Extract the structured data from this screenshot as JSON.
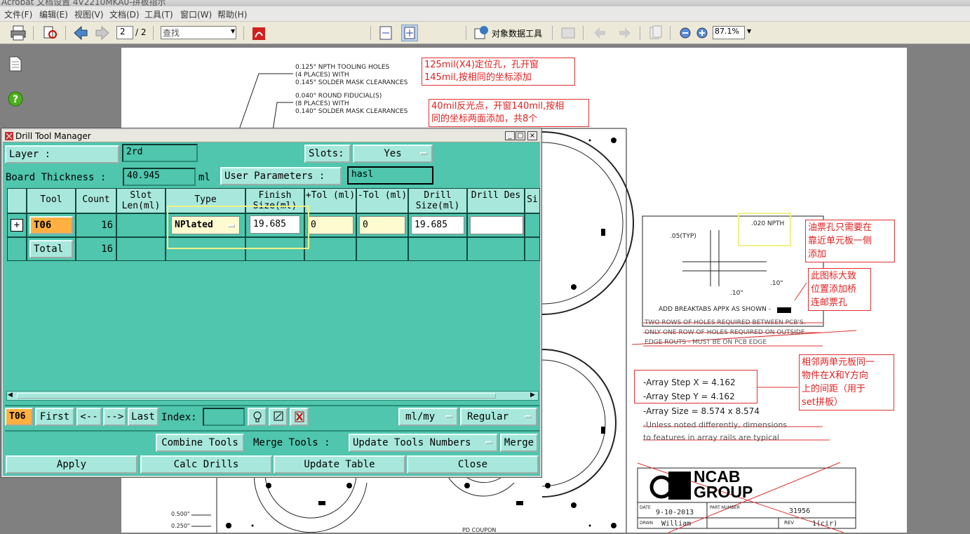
{
  "app": {
    "window_title": "Acrobat 文档设置 4V2210MKA0-拼板指示"
  },
  "menu": [
    "文件(F)",
    "编辑(E)",
    "视图(V)",
    "文档(D)",
    "工具(T)",
    "窗口(W)",
    "帮助(H)"
  ],
  "toolbar": {
    "page_current": "2",
    "page_total": "/ 2",
    "find_placeholder": "查找",
    "object_data_tool": "对象数据工具",
    "zoom": "87.1%"
  },
  "drawing": {
    "hole_note": [
      "0.125\" NPTH TOOLING HOLES",
      "(4 PLACES) WITH",
      "0.145\" SOLDER MASK CLEARANCES"
    ],
    "fid_note": [
      "0.040\" ROUND FIDUCIAL(S)",
      "(8 PLACES) WITH",
      "0.140\" SOLDER MASK CLEARANCES"
    ],
    "npth": ".020 NPTH",
    "typ": ".05(TYP)",
    "dim10a": ".10\"",
    "dim10b": ".10\"",
    "breaktab": "ADD BREAKTABS APPX AS SHOWN -",
    "rows1": "TWO ROWS OF HOLES REQUIRED BETWEEN PCB'S.",
    "rows2": "ONLY ONE ROW OF HOLES REQUIRED ON OUTSIDE",
    "rows3": "EDGE ROUTS - MUST BE ON PCB EDGE",
    "step_x": "-Array Step X = 4.162",
    "step_y": "-Array Step Y = 4.162",
    "array_size": "-Array Size = 8.574 x 8.574",
    "unless1": "-Unless noted differently, dimensions",
    "unless2": "to features in array rails are typical",
    "logo1": "NCAB",
    "logo2": "GROUP",
    "date_label": "DATE",
    "date": "9-10-2013",
    "part_label": "PART NUMBER",
    "part": "31956",
    "drawn_label": "DRWN",
    "drawn": "William",
    "rev_label": "REV",
    "rev": "1(cir)",
    "dim500": "0.500\"",
    "dim250": "0.250\"",
    "pd_coupon": "PD COUPON"
  },
  "notes": {
    "n1": [
      "125mil(X4)定位孔，孔开窗",
      "145mil,按相同的坐标添加"
    ],
    "n2": [
      "40mil反光点，开窗140mil,按相",
      "同的坐标两面添加，共8个"
    ],
    "n3": [
      "油票孔只需要在",
      "靠近单元板一侧",
      "添加"
    ],
    "n4": [
      "此图标大致",
      "位置添加桥",
      "连邮票孔"
    ],
    "n5": [
      "相邻两单元板同一",
      "物件在X和Y方向",
      "上的间距（用于",
      "set拼板）"
    ]
  },
  "dtm": {
    "title": "Drill Tool Manager",
    "layer_label": "Layer             :",
    "layer_value": "2rd",
    "slots_label": "Slots:",
    "slots_value": "Yes",
    "thickness_label": "Board Thickness :",
    "thickness_value": "40.945",
    "thickness_unit": "ml",
    "user_params_label": "User Parameters :",
    "user_params_value": "hasl",
    "columns": [
      "Tool",
      "Count",
      "Slot Len(ml)",
      "Type",
      "Finish Size(ml)",
      "+Tol (ml)",
      "-Tol (ml)",
      "Drill Size(ml)",
      "Drill Des",
      "Si"
    ],
    "row": {
      "expand": "+",
      "tool": "T06",
      "count": "16",
      "type": "NPlated",
      "finish": "19.685",
      "ptol": "0",
      "ntol": "0",
      "drill": "19.685",
      "des": ""
    },
    "total": {
      "label": "Total",
      "count": "16"
    },
    "current_tool": "T06",
    "first": "First",
    "prev": "<--",
    "next": "-->",
    "last": "Last",
    "index_label": "Index:",
    "units": "ml/my",
    "mode": "Regular",
    "combine": "Combine Tools",
    "merge_label": "Merge Tools :",
    "update_numbers": "Update Tools Numbers",
    "merge": "Merge",
    "apply": "Apply",
    "calc": "Calc Drills",
    "update_table": "Update Table",
    "close": "Close"
  }
}
